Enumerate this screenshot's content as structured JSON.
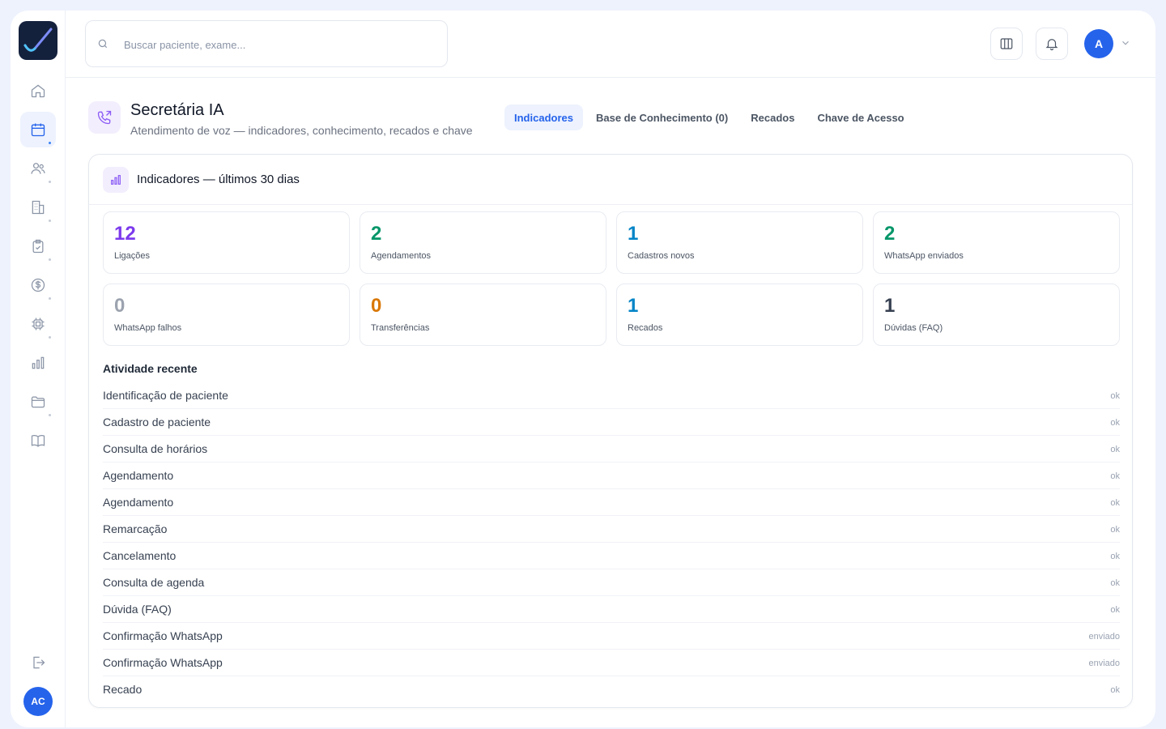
{
  "search": {
    "placeholder": "Buscar paciente, exame..."
  },
  "user": {
    "avatar_initial": "A",
    "sidebar_initials": "AC"
  },
  "page": {
    "title": "Secretária IA",
    "subtitle": "Atendimento de voz — indicadores, conhecimento, recados e chave"
  },
  "tabs": [
    {
      "label": "Indicadores",
      "active": true
    },
    {
      "label": "Base de Conhecimento (0)",
      "active": false
    },
    {
      "label": "Recados",
      "active": false
    },
    {
      "label": "Chave de Acesso",
      "active": false
    }
  ],
  "panel": {
    "title": "Indicadores — últimos 30 dias"
  },
  "stats": [
    {
      "value": "12",
      "label": "Ligações",
      "color": "#7c3aed"
    },
    {
      "value": "2",
      "label": "Agendamentos",
      "color": "#059669"
    },
    {
      "value": "1",
      "label": "Cadastros novos",
      "color": "#0284c7"
    },
    {
      "value": "2",
      "label": "WhatsApp enviados",
      "color": "#059669"
    },
    {
      "value": "0",
      "label": "WhatsApp falhos",
      "color": "#9ca3af"
    },
    {
      "value": "0",
      "label": "Transferências",
      "color": "#d97706"
    },
    {
      "value": "1",
      "label": "Recados",
      "color": "#0284c7"
    },
    {
      "value": "1",
      "label": "Dúvidas (FAQ)",
      "color": "#374151"
    }
  ],
  "activity": {
    "title": "Atividade recente",
    "rows": [
      {
        "name": "Identificação de paciente",
        "status": "ok"
      },
      {
        "name": "Cadastro de paciente",
        "status": "ok"
      },
      {
        "name": "Consulta de horários",
        "status": "ok"
      },
      {
        "name": "Agendamento",
        "status": "ok"
      },
      {
        "name": "Agendamento",
        "status": "ok"
      },
      {
        "name": "Remarcação",
        "status": "ok"
      },
      {
        "name": "Cancelamento",
        "status": "ok"
      },
      {
        "name": "Consulta de agenda",
        "status": "ok"
      },
      {
        "name": "Dúvida (FAQ)",
        "status": "ok"
      },
      {
        "name": "Confirmação WhatsApp",
        "status": "enviado"
      },
      {
        "name": "Confirmação WhatsApp",
        "status": "enviado"
      },
      {
        "name": "Recado",
        "status": "ok"
      }
    ]
  },
  "sidebar_icons": [
    "home-icon",
    "calendar-icon",
    "users-icon",
    "building-icon",
    "clipboard-check-icon",
    "dollar-icon",
    "chip-icon",
    "bar-chart-icon",
    "folder-icon",
    "book-icon"
  ]
}
